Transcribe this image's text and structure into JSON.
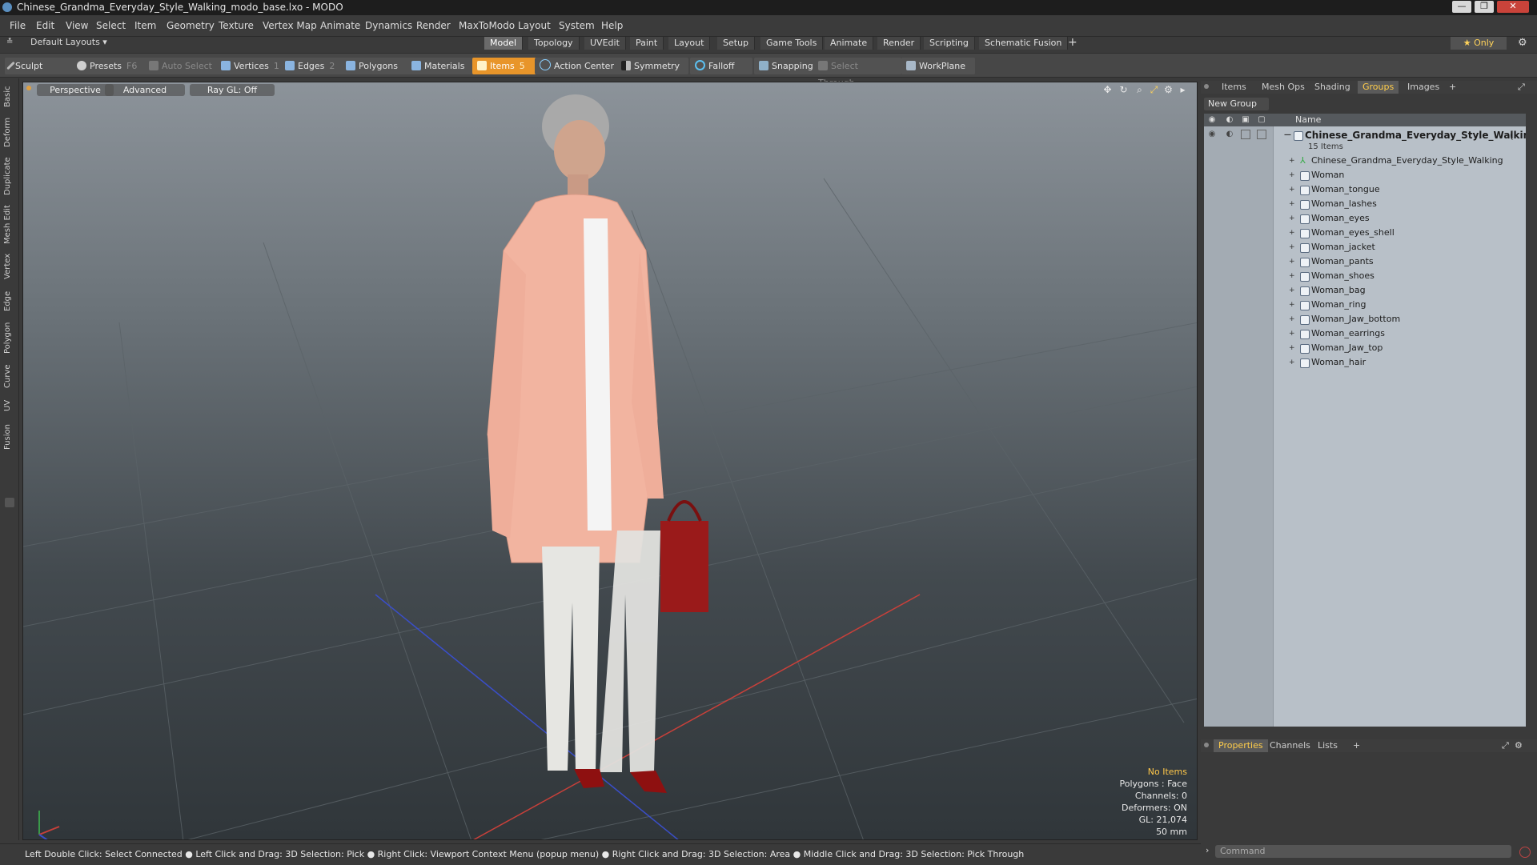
{
  "window": {
    "title": "Chinese_Grandma_Everyday_Style_Walking_modo_base.lxo - MODO",
    "minimize": "—",
    "restore": "❐",
    "close": "✕"
  },
  "menu": [
    "File",
    "Edit",
    "View",
    "Select",
    "Item",
    "Geometry",
    "Texture",
    "Vertex Map",
    "Animate",
    "Dynamics",
    "Render",
    "MaxToModo",
    "Layout",
    "System",
    "Help"
  ],
  "layout_bar": {
    "layouts_label": "Default Layouts ▾",
    "tabs": [
      "Model",
      "Topology",
      "UVEdit",
      "Paint",
      "Layout",
      "Setup",
      "Game Tools",
      "Animate",
      "Render",
      "Scripting",
      "Schematic Fusion"
    ],
    "active_tab": "Model",
    "add_tab": "+",
    "only_label": "★  Only",
    "gear": "⚙"
  },
  "toolbar": {
    "sculpt": "Sculpt",
    "presets": "Presets",
    "presets_key": "F6",
    "auto_select": "Auto Select",
    "vertices": "Vertices",
    "vertices_key": "1",
    "edges": "Edges",
    "edges_key": "2",
    "polygons": "Polygons",
    "materials": "Materials",
    "items": "Items",
    "items_key": "5",
    "action_center": "Action Center",
    "symmetry": "Symmetry",
    "falloff": "Falloff",
    "snapping": "Snapping",
    "select_through": "Select Through",
    "workplane": "WorkPlane"
  },
  "left_tabs": [
    "Basic",
    "Deform",
    "Duplicate",
    "Mesh Edit",
    "Vertex",
    "Edge",
    "Polygon",
    "Curve",
    "UV",
    "Fusion"
  ],
  "viewport": {
    "view_label": "Perspective",
    "shading_label": "Advanced",
    "raygl_label": "Ray GL: Off",
    "stats": {
      "selection": "No Items",
      "polygons": "Polygons : Face",
      "channels": "Channels: 0",
      "deformers": "Deformers: ON",
      "gl": "GL: 21,074",
      "lens": "50 mm"
    }
  },
  "right_panel": {
    "top_tabs": [
      "Items",
      "Mesh Ops",
      "Shading",
      "Groups",
      "Images"
    ],
    "active_top_tab": "Groups",
    "add_tab": "+",
    "new_group": "New Group",
    "column_name": "Name",
    "group_name": "Chinese_Grandma_Everyday_Style_Walking",
    "group_suffix": "(...",
    "group_count": "15 Items",
    "items": [
      "Chinese_Grandma_Everyday_Style_Walking",
      "Woman",
      "Woman_tongue",
      "Woman_lashes",
      "Woman_eyes",
      "Woman_eyes_shell",
      "Woman_jacket",
      "Woman_pants",
      "Woman_shoes",
      "Woman_bag",
      "Woman_ring",
      "Woman_Jaw_bottom",
      "Woman_earrings",
      "Woman_Jaw_top",
      "Woman_hair"
    ],
    "bottom_tabs": [
      "Properties",
      "Channels",
      "Lists"
    ],
    "active_bottom_tab": "Properties",
    "command_placeholder": "Command"
  },
  "status_bar": "Left Double Click: Select Connected ● Left Click and Drag: 3D Selection: Pick ● Right Click: Viewport Context Menu (popup menu) ● Right Click and Drag: 3D Selection: Area ● Middle Click and Drag: 3D Selection: Pick Through"
}
